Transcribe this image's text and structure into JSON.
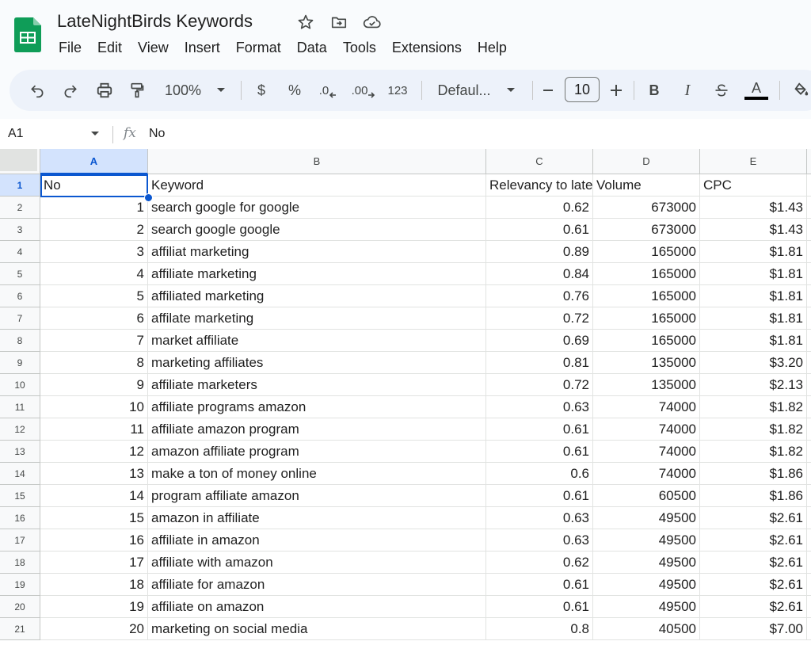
{
  "app": {
    "title": "LateNightBirds Keywords",
    "menus": [
      "File",
      "Edit",
      "View",
      "Insert",
      "Format",
      "Data",
      "Tools",
      "Extensions",
      "Help"
    ]
  },
  "toolbar": {
    "zoom": "100%",
    "currency": "$",
    "percent": "%",
    "decrease_decimal": ".0",
    "increase_decimal": ".00",
    "number_format": "123",
    "font": "Defaul...",
    "font_size": "10",
    "bold": "B",
    "italic": "I",
    "text_color": "A"
  },
  "formula_bar": {
    "cell_ref": "A1",
    "fx": "fx",
    "value": "No"
  },
  "sheet": {
    "columns": [
      "A",
      "B",
      "C",
      "D",
      "E"
    ],
    "rows": [
      {
        "n": "1",
        "no": "No",
        "keyword": "Keyword",
        "relevancy": "Relevancy to late",
        "volume": "Volume",
        "cpc": "CPC"
      },
      {
        "n": "2",
        "no": "1",
        "keyword": "search google for google",
        "relevancy": "0.62",
        "volume": "673000",
        "cpc": "$1.43"
      },
      {
        "n": "3",
        "no": "2",
        "keyword": "search google google",
        "relevancy": "0.61",
        "volume": "673000",
        "cpc": "$1.43"
      },
      {
        "n": "4",
        "no": "3",
        "keyword": "affiliat marketing",
        "relevancy": "0.89",
        "volume": "165000",
        "cpc": "$1.81"
      },
      {
        "n": "5",
        "no": "4",
        "keyword": "affiliate marketing",
        "relevancy": "0.84",
        "volume": "165000",
        "cpc": "$1.81"
      },
      {
        "n": "6",
        "no": "5",
        "keyword": "affiliated marketing",
        "relevancy": "0.76",
        "volume": "165000",
        "cpc": "$1.81"
      },
      {
        "n": "7",
        "no": "6",
        "keyword": "affilate marketing",
        "relevancy": "0.72",
        "volume": "165000",
        "cpc": "$1.81"
      },
      {
        "n": "8",
        "no": "7",
        "keyword": "market affiliate",
        "relevancy": "0.69",
        "volume": "165000",
        "cpc": "$1.81"
      },
      {
        "n": "9",
        "no": "8",
        "keyword": "marketing affiliates",
        "relevancy": "0.81",
        "volume": "135000",
        "cpc": "$3.20"
      },
      {
        "n": "10",
        "no": "9",
        "keyword": "affiliate marketers",
        "relevancy": "0.72",
        "volume": "135000",
        "cpc": "$2.13"
      },
      {
        "n": "11",
        "no": "10",
        "keyword": "affiliate programs amazon",
        "relevancy": "0.63",
        "volume": "74000",
        "cpc": "$1.82"
      },
      {
        "n": "12",
        "no": "11",
        "keyword": "affiliate amazon program",
        "relevancy": "0.61",
        "volume": "74000",
        "cpc": "$1.82"
      },
      {
        "n": "13",
        "no": "12",
        "keyword": "amazon affiliate program",
        "relevancy": "0.61",
        "volume": "74000",
        "cpc": "$1.82"
      },
      {
        "n": "14",
        "no": "13",
        "keyword": "make a ton of money online",
        "relevancy": "0.6",
        "volume": "74000",
        "cpc": "$1.86"
      },
      {
        "n": "15",
        "no": "14",
        "keyword": "program affiliate amazon",
        "relevancy": "0.61",
        "volume": "60500",
        "cpc": "$1.86"
      },
      {
        "n": "16",
        "no": "15",
        "keyword": "amazon in affiliate",
        "relevancy": "0.63",
        "volume": "49500",
        "cpc": "$2.61"
      },
      {
        "n": "17",
        "no": "16",
        "keyword": "affiliate in amazon",
        "relevancy": "0.63",
        "volume": "49500",
        "cpc": "$2.61"
      },
      {
        "n": "18",
        "no": "17",
        "keyword": "affiliate with amazon",
        "relevancy": "0.62",
        "volume": "49500",
        "cpc": "$2.61"
      },
      {
        "n": "19",
        "no": "18",
        "keyword": "affiliate for amazon",
        "relevancy": "0.61",
        "volume": "49500",
        "cpc": "$2.61"
      },
      {
        "n": "20",
        "no": "19",
        "keyword": "affiliate on amazon",
        "relevancy": "0.61",
        "volume": "49500",
        "cpc": "$2.61"
      },
      {
        "n": "21",
        "no": "20",
        "keyword": "marketing on social media",
        "relevancy": "0.8",
        "volume": "40500",
        "cpc": "$7.00"
      }
    ]
  },
  "colors": {
    "brand_green": "#0f9d58",
    "selection_blue": "#0b57d0",
    "toolbar_bg": "#edf2fa"
  }
}
